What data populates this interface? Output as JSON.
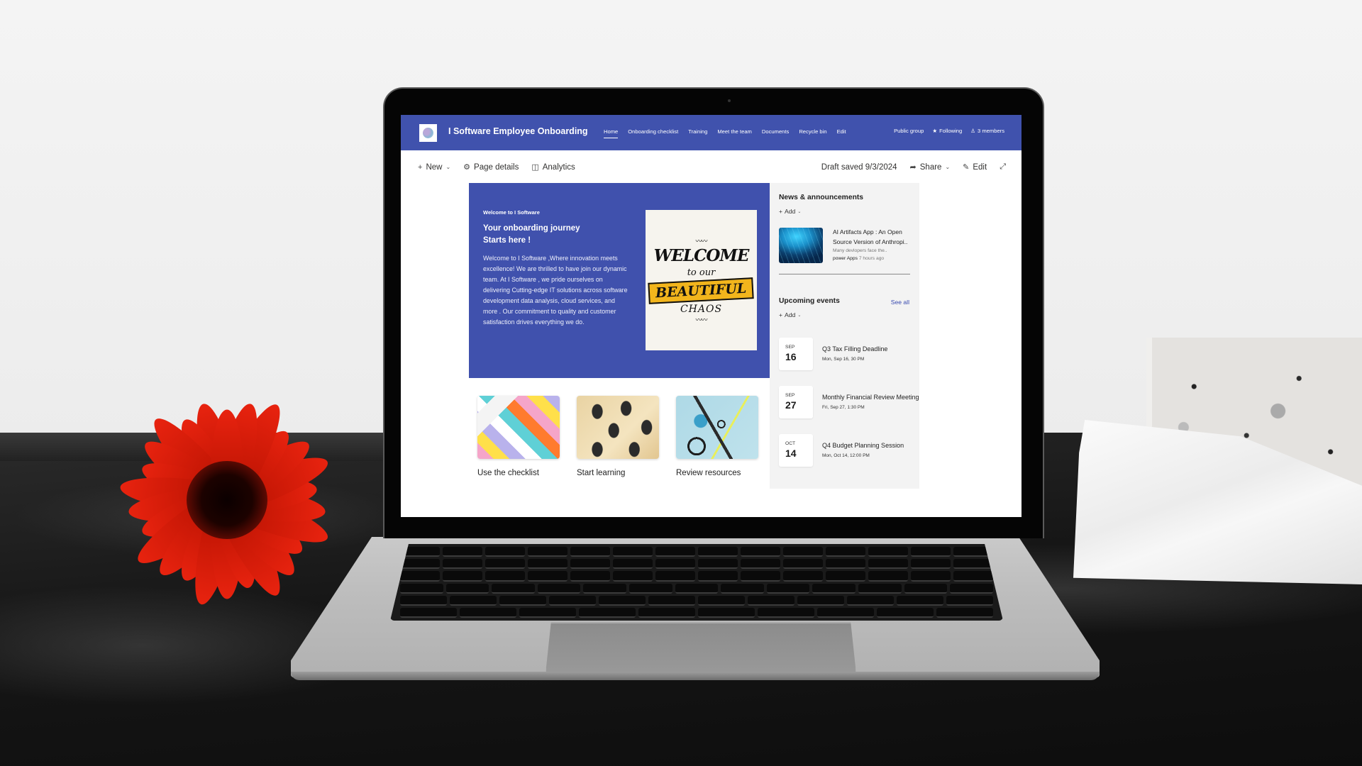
{
  "site": {
    "title": "I Software Employee Onboarding",
    "logo_icon": "globe-logo-icon",
    "brand_color": "#4052AD"
  },
  "nav": {
    "items": [
      {
        "label": "Home",
        "active": true
      },
      {
        "label": "Onboarding checklist",
        "active": false
      },
      {
        "label": "Training",
        "active": false
      },
      {
        "label": "Meet the team",
        "active": false
      },
      {
        "label": "Documents",
        "active": false
      },
      {
        "label": "Recycle bin",
        "active": false
      },
      {
        "label": "Edit",
        "active": false
      }
    ]
  },
  "header_right": {
    "group_type": "Public group",
    "following": {
      "icon": "star-icon",
      "label": "Following"
    },
    "members": {
      "icon": "person-icon",
      "label": "3 members"
    }
  },
  "command_bar": {
    "new": {
      "icon": "plus-icon",
      "label": "New"
    },
    "page_details": {
      "icon": "gear-icon",
      "label": "Page details"
    },
    "analytics": {
      "icon": "chart-icon",
      "label": "Analytics"
    },
    "draft_status": "Draft saved 9/3/2024",
    "share": {
      "icon": "share-icon",
      "label": "Share"
    },
    "edit": {
      "icon": "pencil-icon",
      "label": "Edit"
    },
    "expand_icon": "expand-icon"
  },
  "hero": {
    "eyebrow": "Welcome to I Software",
    "title_line1": "Your onboarding journey",
    "title_line2": "Starts here !",
    "body": "Welcome to I Software ,Where innovation meets excellence! We are thrilled to have join our dynamic team. At I Software , we pride ourselves on delivering Cutting-edge IT solutions across software development data analysis, cloud services, and more . Our commitment to quality and customer satisfaction drives everything we do.",
    "image": {
      "line1": "WELCOME",
      "line2": "to our",
      "line3": "BEAUTIFUL",
      "line4": "CHAOS",
      "accent_color": "#F2B51C"
    }
  },
  "quick_links": [
    {
      "label": "Use the checklist",
      "thumb": "colorful-sticky-notes"
    },
    {
      "label": "Start learning",
      "thumb": "classroom-chairs"
    },
    {
      "label": "Review resources",
      "thumb": "office-supplies"
    }
  ],
  "news": {
    "title": "News & announcements",
    "add_label": "Add",
    "items": [
      {
        "title": "AI Artifacts App : An Open Source Version of Anthropi..",
        "description": "Many devlopers face the..",
        "author": "power Apps",
        "time": "7 hours ago"
      }
    ]
  },
  "events": {
    "title": "Upcoming events",
    "see_all_label": "See all",
    "add_label": "Add",
    "items": [
      {
        "month": "SEP",
        "day": "16",
        "title": "Q3 Tax Filling Deadline",
        "time": "Mon, Sep 16, 30 PM"
      },
      {
        "month": "SEP",
        "day": "27",
        "title": "Monthly Financial Review Meeting",
        "time": "Fri, Sep 27, 1:30 PM"
      },
      {
        "month": "OCT",
        "day": "14",
        "title": "Q4 Budget Planning Session",
        "time": "Mon, Oct 14, 12:00 PM"
      }
    ]
  }
}
